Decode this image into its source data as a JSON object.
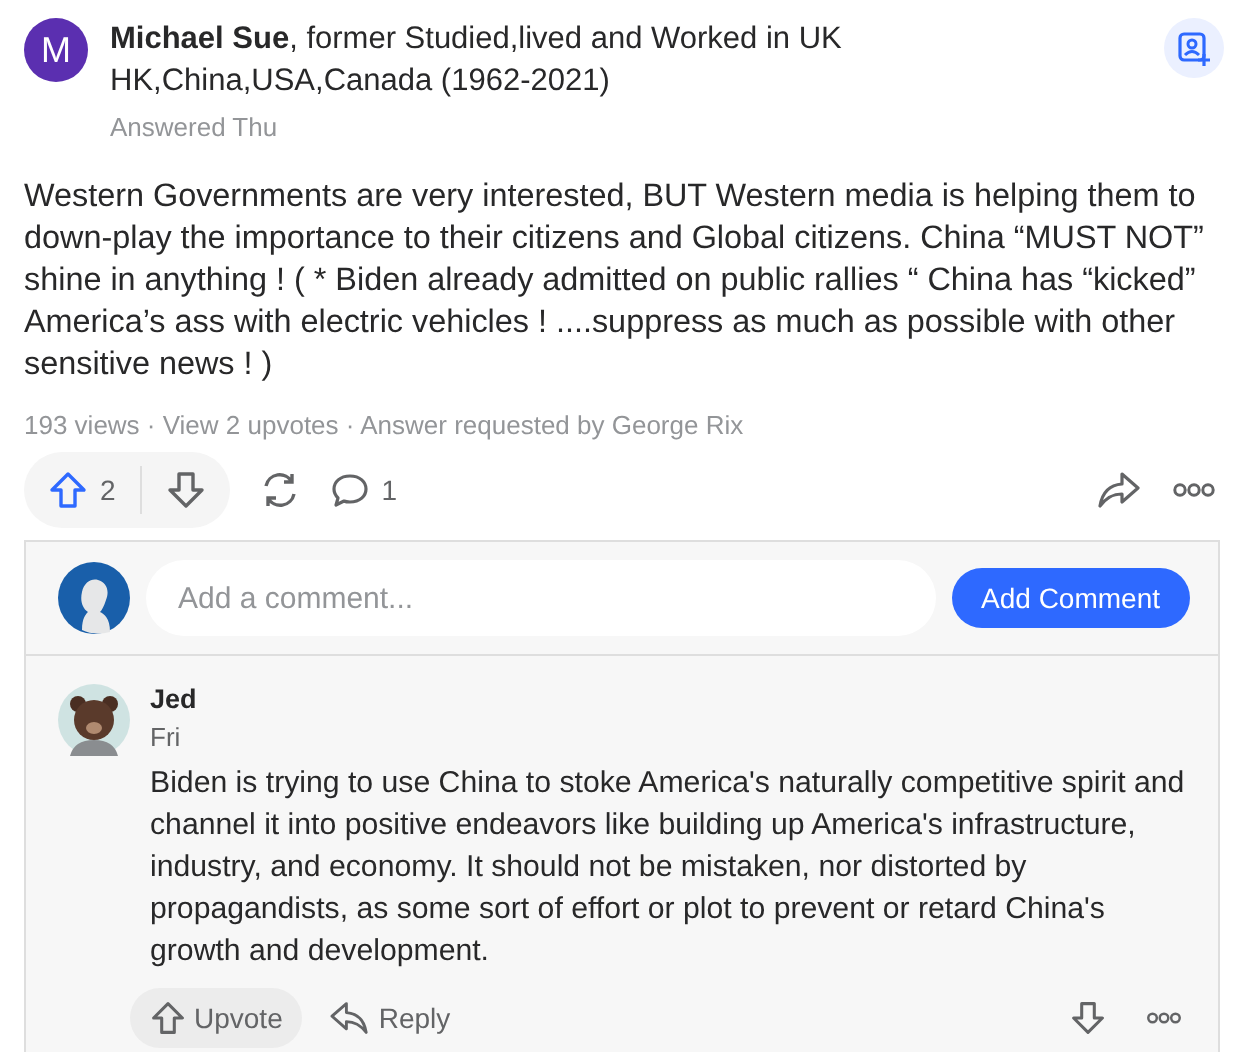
{
  "answer": {
    "avatar_letter": "M",
    "author": "**Michael Sue**, former Studied,lived and Worked in UK HK,China,USA,Canada (1962-2021)",
    "date": "Answered Thu",
    "body": "Western Governments are very interested, BUT Western media is helping them to down-play the importance to their citizens and Global citizens. China “MUST NOT” shine in anything ! ( * Biden already admitted on public rallies “ China has “kicked” America’s ass with electric vehicles ! ....suppress as much as possible with other sensitive news ! )",
    "meta": "193 views · View 2 upvotes · Answer requested by George Rix",
    "upvoted": true,
    "upvotes": "2",
    "comments": "1"
  },
  "composer": {
    "placeholder": "Add a comment...",
    "button": "Add Comment"
  },
  "comments": [
    {
      "author": "Jed",
      "date": "Fri",
      "text": "Biden is trying to use China to stoke America's naturally competitive spirit and channel it into positive endeavors like building up America's infrastructure, industry, and economy. It should not be mistaken, nor distorted by propagandists, as some sort of effort or plot to prevent or retard China's growth and development.",
      "upvote": "Upvote",
      "reply": "Reply"
    }
  ]
}
